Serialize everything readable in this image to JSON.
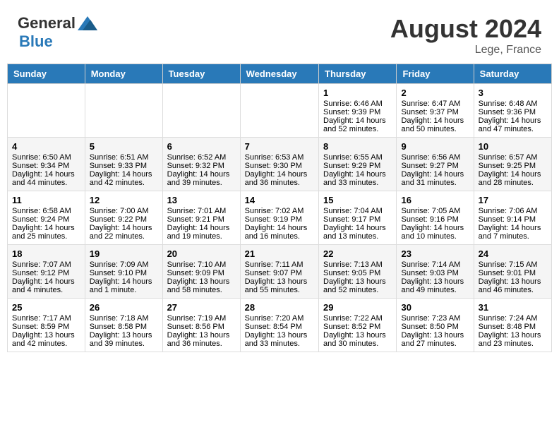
{
  "header": {
    "logo_general": "General",
    "logo_blue": "Blue",
    "month": "August 2024",
    "location": "Lege, France"
  },
  "weekdays": [
    "Sunday",
    "Monday",
    "Tuesday",
    "Wednesday",
    "Thursday",
    "Friday",
    "Saturday"
  ],
  "weeks": [
    {
      "days": [
        {
          "num": "",
          "sunrise": "",
          "sunset": "",
          "daylight": ""
        },
        {
          "num": "",
          "sunrise": "",
          "sunset": "",
          "daylight": ""
        },
        {
          "num": "",
          "sunrise": "",
          "sunset": "",
          "daylight": ""
        },
        {
          "num": "",
          "sunrise": "",
          "sunset": "",
          "daylight": ""
        },
        {
          "num": "1",
          "sunrise": "Sunrise: 6:46 AM",
          "sunset": "Sunset: 9:39 PM",
          "daylight": "Daylight: 14 hours and 52 minutes."
        },
        {
          "num": "2",
          "sunrise": "Sunrise: 6:47 AM",
          "sunset": "Sunset: 9:37 PM",
          "daylight": "Daylight: 14 hours and 50 minutes."
        },
        {
          "num": "3",
          "sunrise": "Sunrise: 6:48 AM",
          "sunset": "Sunset: 9:36 PM",
          "daylight": "Daylight: 14 hours and 47 minutes."
        }
      ]
    },
    {
      "days": [
        {
          "num": "4",
          "sunrise": "Sunrise: 6:50 AM",
          "sunset": "Sunset: 9:34 PM",
          "daylight": "Daylight: 14 hours and 44 minutes."
        },
        {
          "num": "5",
          "sunrise": "Sunrise: 6:51 AM",
          "sunset": "Sunset: 9:33 PM",
          "daylight": "Daylight: 14 hours and 42 minutes."
        },
        {
          "num": "6",
          "sunrise": "Sunrise: 6:52 AM",
          "sunset": "Sunset: 9:32 PM",
          "daylight": "Daylight: 14 hours and 39 minutes."
        },
        {
          "num": "7",
          "sunrise": "Sunrise: 6:53 AM",
          "sunset": "Sunset: 9:30 PM",
          "daylight": "Daylight: 14 hours and 36 minutes."
        },
        {
          "num": "8",
          "sunrise": "Sunrise: 6:55 AM",
          "sunset": "Sunset: 9:29 PM",
          "daylight": "Daylight: 14 hours and 33 minutes."
        },
        {
          "num": "9",
          "sunrise": "Sunrise: 6:56 AM",
          "sunset": "Sunset: 9:27 PM",
          "daylight": "Daylight: 14 hours and 31 minutes."
        },
        {
          "num": "10",
          "sunrise": "Sunrise: 6:57 AM",
          "sunset": "Sunset: 9:25 PM",
          "daylight": "Daylight: 14 hours and 28 minutes."
        }
      ]
    },
    {
      "days": [
        {
          "num": "11",
          "sunrise": "Sunrise: 6:58 AM",
          "sunset": "Sunset: 9:24 PM",
          "daylight": "Daylight: 14 hours and 25 minutes."
        },
        {
          "num": "12",
          "sunrise": "Sunrise: 7:00 AM",
          "sunset": "Sunset: 9:22 PM",
          "daylight": "Daylight: 14 hours and 22 minutes."
        },
        {
          "num": "13",
          "sunrise": "Sunrise: 7:01 AM",
          "sunset": "Sunset: 9:21 PM",
          "daylight": "Daylight: 14 hours and 19 minutes."
        },
        {
          "num": "14",
          "sunrise": "Sunrise: 7:02 AM",
          "sunset": "Sunset: 9:19 PM",
          "daylight": "Daylight: 14 hours and 16 minutes."
        },
        {
          "num": "15",
          "sunrise": "Sunrise: 7:04 AM",
          "sunset": "Sunset: 9:17 PM",
          "daylight": "Daylight: 14 hours and 13 minutes."
        },
        {
          "num": "16",
          "sunrise": "Sunrise: 7:05 AM",
          "sunset": "Sunset: 9:16 PM",
          "daylight": "Daylight: 14 hours and 10 minutes."
        },
        {
          "num": "17",
          "sunrise": "Sunrise: 7:06 AM",
          "sunset": "Sunset: 9:14 PM",
          "daylight": "Daylight: 14 hours and 7 minutes."
        }
      ]
    },
    {
      "days": [
        {
          "num": "18",
          "sunrise": "Sunrise: 7:07 AM",
          "sunset": "Sunset: 9:12 PM",
          "daylight": "Daylight: 14 hours and 4 minutes."
        },
        {
          "num": "19",
          "sunrise": "Sunrise: 7:09 AM",
          "sunset": "Sunset: 9:10 PM",
          "daylight": "Daylight: 14 hours and 1 minute."
        },
        {
          "num": "20",
          "sunrise": "Sunrise: 7:10 AM",
          "sunset": "Sunset: 9:09 PM",
          "daylight": "Daylight: 13 hours and 58 minutes."
        },
        {
          "num": "21",
          "sunrise": "Sunrise: 7:11 AM",
          "sunset": "Sunset: 9:07 PM",
          "daylight": "Daylight: 13 hours and 55 minutes."
        },
        {
          "num": "22",
          "sunrise": "Sunrise: 7:13 AM",
          "sunset": "Sunset: 9:05 PM",
          "daylight": "Daylight: 13 hours and 52 minutes."
        },
        {
          "num": "23",
          "sunrise": "Sunrise: 7:14 AM",
          "sunset": "Sunset: 9:03 PM",
          "daylight": "Daylight: 13 hours and 49 minutes."
        },
        {
          "num": "24",
          "sunrise": "Sunrise: 7:15 AM",
          "sunset": "Sunset: 9:01 PM",
          "daylight": "Daylight: 13 hours and 46 minutes."
        }
      ]
    },
    {
      "days": [
        {
          "num": "25",
          "sunrise": "Sunrise: 7:17 AM",
          "sunset": "Sunset: 8:59 PM",
          "daylight": "Daylight: 13 hours and 42 minutes."
        },
        {
          "num": "26",
          "sunrise": "Sunrise: 7:18 AM",
          "sunset": "Sunset: 8:58 PM",
          "daylight": "Daylight: 13 hours and 39 minutes."
        },
        {
          "num": "27",
          "sunrise": "Sunrise: 7:19 AM",
          "sunset": "Sunset: 8:56 PM",
          "daylight": "Daylight: 13 hours and 36 minutes."
        },
        {
          "num": "28",
          "sunrise": "Sunrise: 7:20 AM",
          "sunset": "Sunset: 8:54 PM",
          "daylight": "Daylight: 13 hours and 33 minutes."
        },
        {
          "num": "29",
          "sunrise": "Sunrise: 7:22 AM",
          "sunset": "Sunset: 8:52 PM",
          "daylight": "Daylight: 13 hours and 30 minutes."
        },
        {
          "num": "30",
          "sunrise": "Sunrise: 7:23 AM",
          "sunset": "Sunset: 8:50 PM",
          "daylight": "Daylight: 13 hours and 27 minutes."
        },
        {
          "num": "31",
          "sunrise": "Sunrise: 7:24 AM",
          "sunset": "Sunset: 8:48 PM",
          "daylight": "Daylight: 13 hours and 23 minutes."
        }
      ]
    }
  ]
}
